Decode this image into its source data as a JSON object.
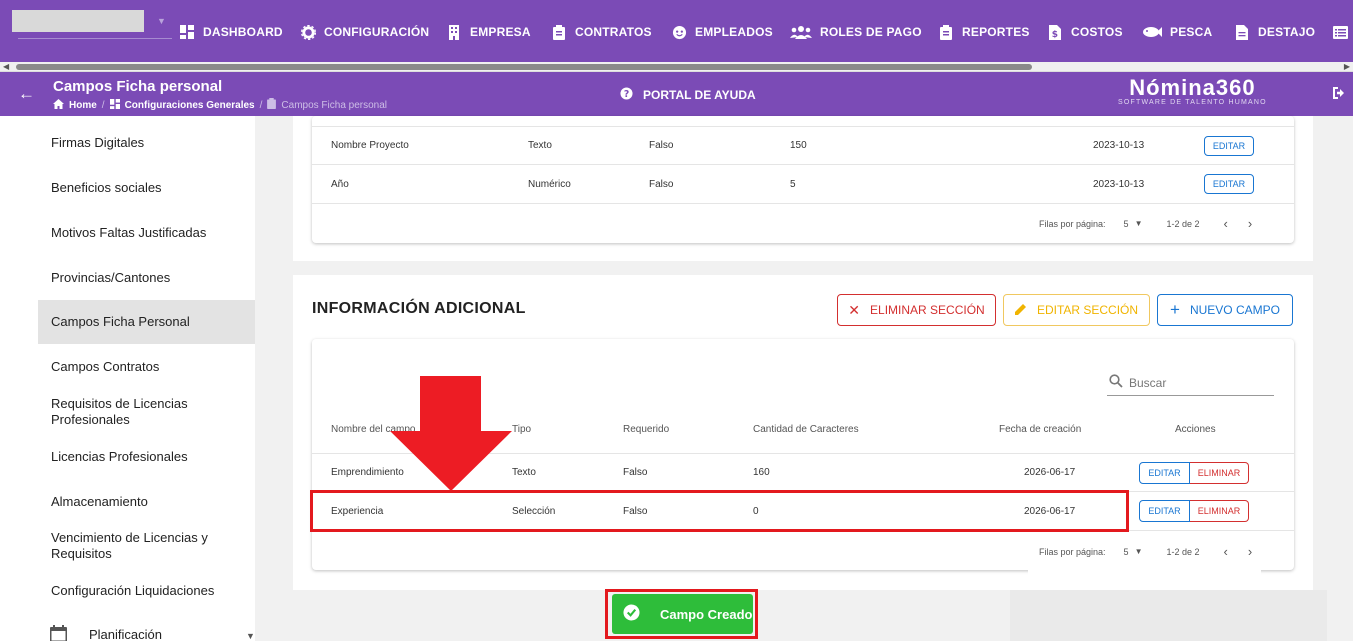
{
  "nav": {
    "items": [
      {
        "label": "DASHBOARD",
        "icon": "dashboard-icon"
      },
      {
        "label": "CONFIGURACIÓN",
        "icon": "gear-icon"
      },
      {
        "label": "EMPRESA",
        "icon": "building-icon"
      },
      {
        "label": "CONTRATOS",
        "icon": "clipboard-icon"
      },
      {
        "label": "EMPLEADOS",
        "icon": "face-icon"
      },
      {
        "label": "ROLES DE PAGO",
        "icon": "group-icon"
      },
      {
        "label": "REPORTES",
        "icon": "clipboard-icon"
      },
      {
        "label": "COSTOS",
        "icon": "dollar-file-icon"
      },
      {
        "label": "PESCA",
        "icon": "fish-icon"
      },
      {
        "label": "DESTAJO",
        "icon": "document-icon"
      }
    ]
  },
  "header": {
    "title": "Campos Ficha personal",
    "breadcrumb": [
      "Home",
      "Configuraciones Generales",
      "Campos Ficha personal"
    ],
    "help": "PORTAL DE AYUDA",
    "logo": "Nómina360",
    "logo_sub": "SOFTWARE DE TALENTO HUMANO"
  },
  "sidebar": {
    "items": [
      "Firmas Digitales",
      "Beneficios sociales",
      "Motivos Faltas Justificadas",
      "Provincias/Cantones",
      "Campos Ficha Personal",
      "Campos Contratos",
      "Requisitos de Licencias Profesionales",
      "Licencias Profesionales",
      "Almacenamiento",
      "Vencimiento de Licencias y Requisitos",
      "Configuración Liquidaciones",
      "Planificación"
    ],
    "active_index": 4
  },
  "top_table": {
    "rows": [
      {
        "name": "Nombre Proyecto",
        "type": "Texto",
        "required": "Falso",
        "chars": "150",
        "date": "2023-10-13",
        "edit": "EDITAR"
      },
      {
        "name": "Año",
        "type": "Numérico",
        "required": "Falso",
        "chars": "5",
        "date": "2023-10-13",
        "edit": "EDITAR"
      }
    ],
    "pager": {
      "rows_label": "Filas por página:",
      "rows_value": "5",
      "range": "1-2 de 2"
    }
  },
  "info_section": {
    "title": "INFORMACIÓN ADICIONAL",
    "btn_delete": "ELIMINAR SECCIÓN",
    "btn_edit": "EDITAR SECCIÓN",
    "btn_new": "NUEVO CAMPO",
    "search_placeholder": "Buscar",
    "headers": {
      "name": "Nombre del campo",
      "type": "Tipo",
      "required": "Requerido",
      "chars": "Cantidad de Caracteres",
      "date": "Fecha de creación",
      "actions": "Acciones"
    },
    "rows": [
      {
        "name": "Emprendimiento",
        "type": "Texto",
        "required": "Falso",
        "chars": "160",
        "date": "2026-06-17",
        "edit": "EDITAR",
        "delete": "ELIMINAR"
      },
      {
        "name": "Experiencia",
        "type": "Selección",
        "required": "Falso",
        "chars": "0",
        "date": "2026-06-17",
        "edit": "EDITAR",
        "delete": "ELIMINAR"
      }
    ],
    "pager": {
      "rows_label": "Filas por página:",
      "rows_value": "5",
      "range": "1-2 de 2"
    }
  },
  "snackbar": {
    "message": "Campo Creado"
  },
  "colors": {
    "primary": "#7b4bb6",
    "success": "#2ebd3a",
    "annotation": "#e3191e",
    "edit": "#1976d2",
    "delete": "#d32f2f",
    "warn": "#f0b400"
  }
}
